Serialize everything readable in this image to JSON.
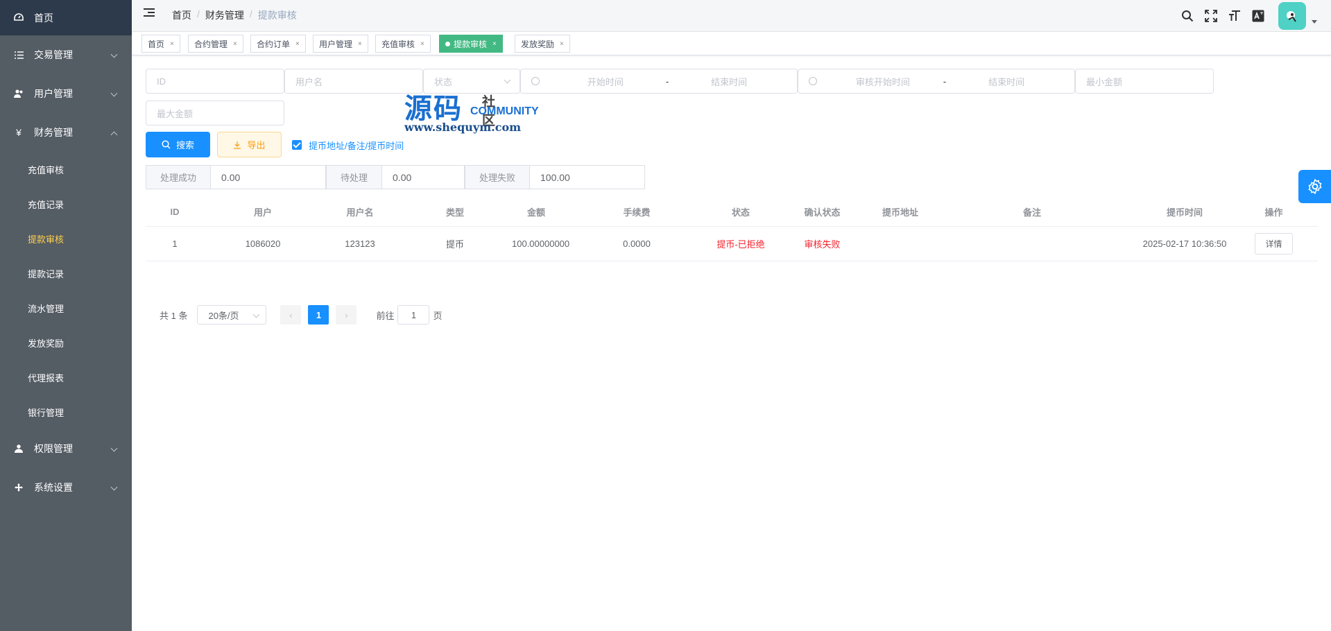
{
  "sidebar": {
    "home": "首页",
    "items": [
      {
        "label": "交易管理",
        "icon": "list-icon"
      },
      {
        "label": "用户管理",
        "icon": "users-icon"
      },
      {
        "label": "财务管理",
        "icon": "yen-icon"
      }
    ],
    "sub_items": [
      {
        "label": "充值审核"
      },
      {
        "label": "充值记录"
      },
      {
        "label": "提款审核",
        "active": true
      },
      {
        "label": "提款记录"
      },
      {
        "label": "流水管理"
      },
      {
        "label": "发放奖励"
      },
      {
        "label": "代理报表"
      },
      {
        "label": "银行管理"
      }
    ],
    "bottom_items": [
      {
        "label": "权限管理",
        "icon": "user-icon"
      },
      {
        "label": "系统设置",
        "icon": "settings-icon"
      }
    ]
  },
  "breadcrumb": {
    "home": "首页",
    "section": "财务管理",
    "current": "提款审核",
    "sep": "/"
  },
  "tags": [
    "首页",
    "合约管理",
    "合约订单",
    "用户管理",
    "充值审核",
    "提款审核",
    "发放奖励"
  ],
  "filters": {
    "id": "ID",
    "username": "用户名",
    "status": "状态",
    "start_time": "开始时间",
    "end_time": "结束时间",
    "audit_start": "审核开始时间",
    "audit_end": "结束时间",
    "min_amount": "最小金额",
    "max_amount": "最大金额",
    "range_sep": "-"
  },
  "actions": {
    "search": "搜索",
    "export": "导出",
    "checkbox_label": "提币地址/备注/提币时间"
  },
  "summary": [
    {
      "label": "处理成功",
      "value": "0.00"
    },
    {
      "label": "待处理",
      "value": "0.00"
    },
    {
      "label": "处理失败",
      "value": "100.00"
    }
  ],
  "table": {
    "columns": [
      "ID",
      "用户",
      "用户名",
      "类型",
      "金额",
      "手续费",
      "状态",
      "确认状态",
      "提币地址",
      "备注",
      "提币时间",
      "操作"
    ],
    "rows": [
      {
        "id": "1",
        "user": "1086020",
        "username": "123123",
        "type": "提币",
        "amount": "100.00000000",
        "fee": "0.0000",
        "status": "提币-已拒绝",
        "confirm": "审核失败",
        "address": "",
        "note": "",
        "time": "2025-02-17 10:36:50",
        "action": "详情"
      }
    ]
  },
  "pagination": {
    "total": "共 1 条",
    "page_size": "20条/页",
    "current": "1",
    "goto": "前往",
    "goto_value": "1",
    "page_suffix": "页"
  },
  "watermark": {
    "big": "源码",
    "sm1": "社区",
    "sm2": "COMMUNITY",
    "url": "www.shequym.com"
  },
  "colors": {
    "sidebar": "#545c64",
    "active_menu": "#ffd04b",
    "primary": "#1890ff",
    "active_tag": "#42b983",
    "danger": "#f5222d"
  }
}
